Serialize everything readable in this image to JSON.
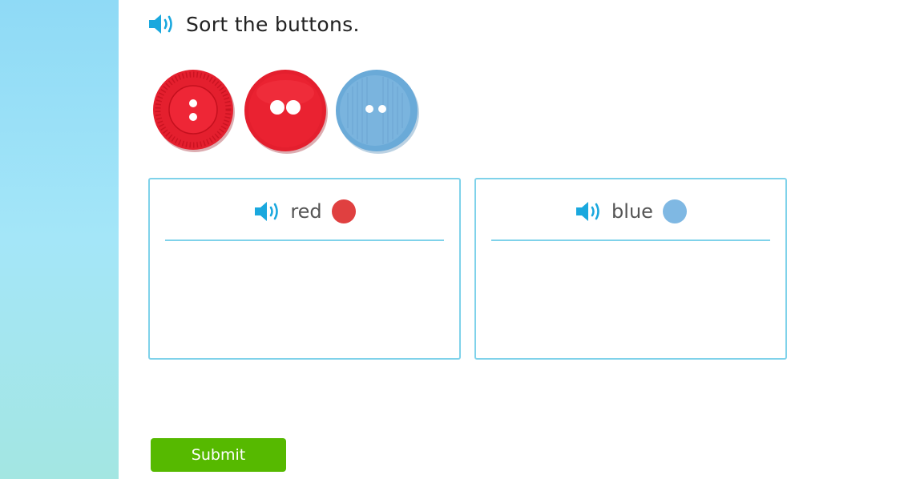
{
  "question": {
    "icon": "speaker-icon",
    "text": "Sort the buttons."
  },
  "buttons": [
    {
      "color": "red",
      "hex": "#e41f2e",
      "holes": 2,
      "style": "textured"
    },
    {
      "color": "red",
      "hex": "#e41f2e",
      "holes": 2,
      "style": "plain"
    },
    {
      "color": "blue",
      "hex": "#7ab4de",
      "holes": 2,
      "style": "striped"
    }
  ],
  "categories": [
    {
      "label": "red",
      "icon": "speaker-icon",
      "swatch": "#e04040"
    },
    {
      "label": "blue",
      "icon": "speaker-icon",
      "swatch": "#7fb8e3"
    }
  ],
  "submit_label": "Submit",
  "colors": {
    "accent": "#1aa8de",
    "box_border": "#7fd2ea",
    "submit": "#56b900"
  }
}
